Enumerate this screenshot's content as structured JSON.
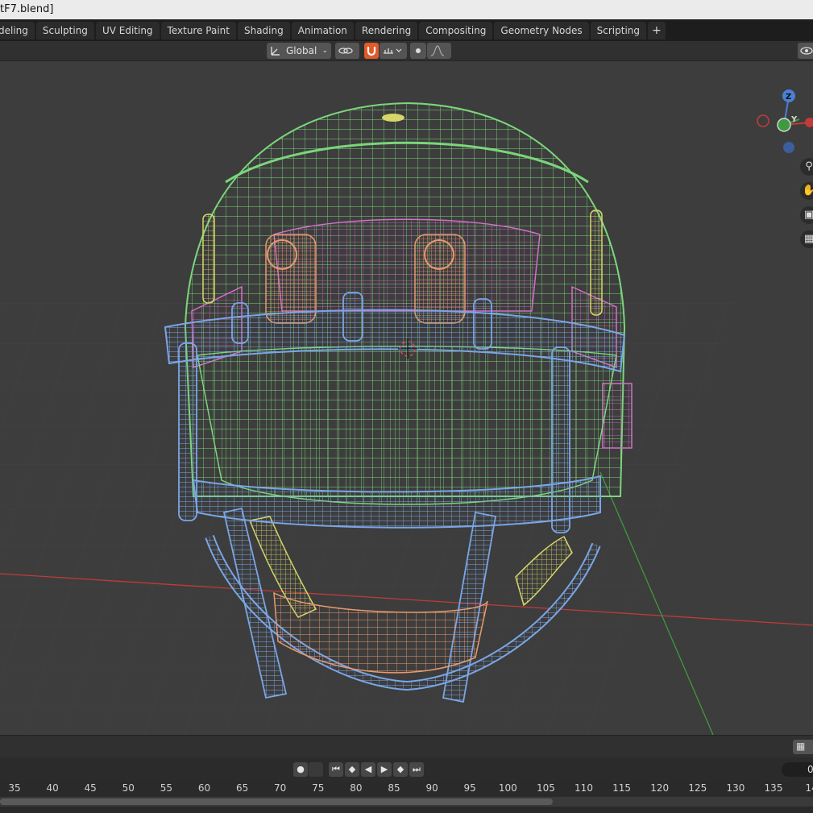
{
  "window": {
    "title": "tF7.blend]"
  },
  "workspace_tabs": [
    {
      "label": "deling"
    },
    {
      "label": "Sculpting"
    },
    {
      "label": "UV Editing"
    },
    {
      "label": "Texture Paint"
    },
    {
      "label": "Shading"
    },
    {
      "label": "Animation"
    },
    {
      "label": "Rendering"
    },
    {
      "label": "Compositing"
    },
    {
      "label": "Geometry Nodes"
    },
    {
      "label": "Scripting"
    }
  ],
  "add_tab_label": "+",
  "header": {
    "transform_orientation": "Global"
  },
  "gizmo": {
    "z_label": "Z",
    "y_label": "Y"
  },
  "playback": {
    "current_frame": "0"
  },
  "timeline": {
    "ticks": [
      "35",
      "40",
      "45",
      "50",
      "55",
      "60",
      "65",
      "70",
      "75",
      "80",
      "85",
      "90",
      "95",
      "100",
      "105",
      "110",
      "115",
      "120",
      "125",
      "130",
      "135",
      "14"
    ]
  },
  "colors": {
    "helmet_shell": "#7bd67b",
    "facemask": "#7aa6e6",
    "hardware": "#e89a6e",
    "straps": "#d6d66a",
    "padding": "#d070c8",
    "x_axis": "#c23a3a",
    "y_axis": "#3e9a3e"
  }
}
